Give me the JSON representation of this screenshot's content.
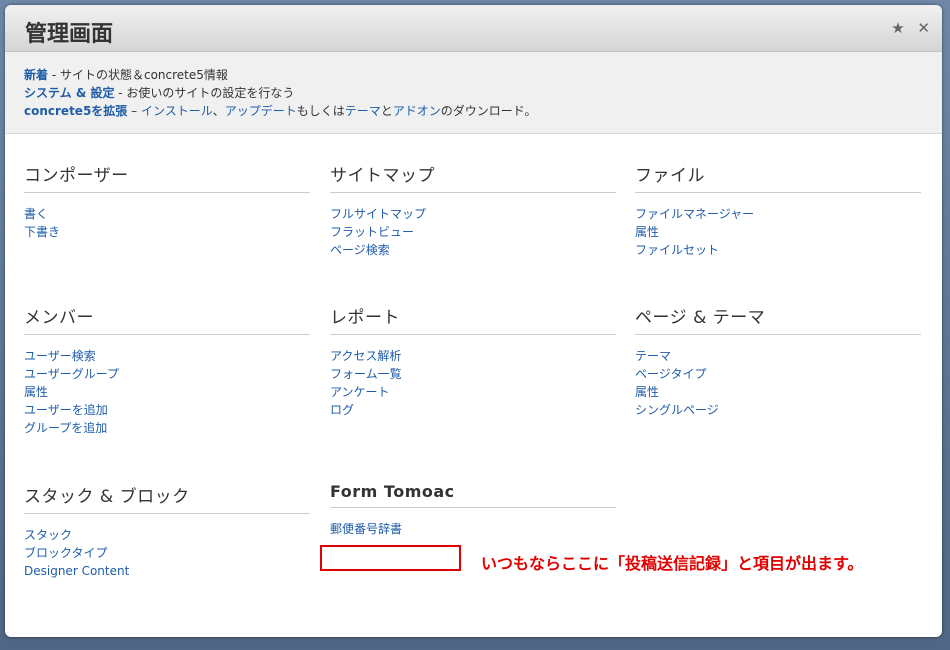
{
  "header": {
    "title": "管理画面",
    "star_icon": "★",
    "close_icon": "✕"
  },
  "intro": {
    "line1_link": "新着",
    "line1_text": " - サイトの状態＆concrete5情報",
    "line2_link": "システム & 設定",
    "line2_text": " - お使いのサイトの設定を行なう",
    "line3_link": "concrete5を拡張",
    "line3_dash": " – ",
    "line3_a": "インストール",
    "line3_sep": "、",
    "line3_b": "アップデート",
    "line3_mid1": "もしくは",
    "line3_c": "テーマ",
    "line3_mid2": "と",
    "line3_d": "アドオン",
    "line3_end": "のダウンロード。"
  },
  "sections": [
    {
      "title": "コンポーザー",
      "items": [
        "書く",
        "下書き"
      ]
    },
    {
      "title": "サイトマップ",
      "items": [
        "フルサイトマップ",
        "フラットビュー",
        "ページ検索"
      ]
    },
    {
      "title": "ファイル",
      "items": [
        "ファイルマネージャー",
        "属性",
        "ファイルセット"
      ]
    },
    {
      "title": "メンバー",
      "items": [
        "ユーザー検索",
        "ユーザーグループ",
        "属性",
        "ユーザーを追加",
        "グループを追加"
      ]
    },
    {
      "title": "レポート",
      "items": [
        "アクセス解析",
        "フォーム一覧",
        "アンケート",
        "ログ"
      ]
    },
    {
      "title": "ページ & テーマ",
      "items": [
        "テーマ",
        "ページタイプ",
        "属性",
        "シングルページ"
      ]
    },
    {
      "title": "スタック & ブロック",
      "items": [
        "スタック",
        "ブロックタイプ",
        "Designer Content"
      ]
    },
    {
      "title": "Form Tomoac",
      "items": [
        "郵便番号辞書"
      ]
    }
  ],
  "annotation": {
    "note": "いつもならここに「投稿送信記録」と項目が出ます。",
    "color": "#e00000"
  }
}
